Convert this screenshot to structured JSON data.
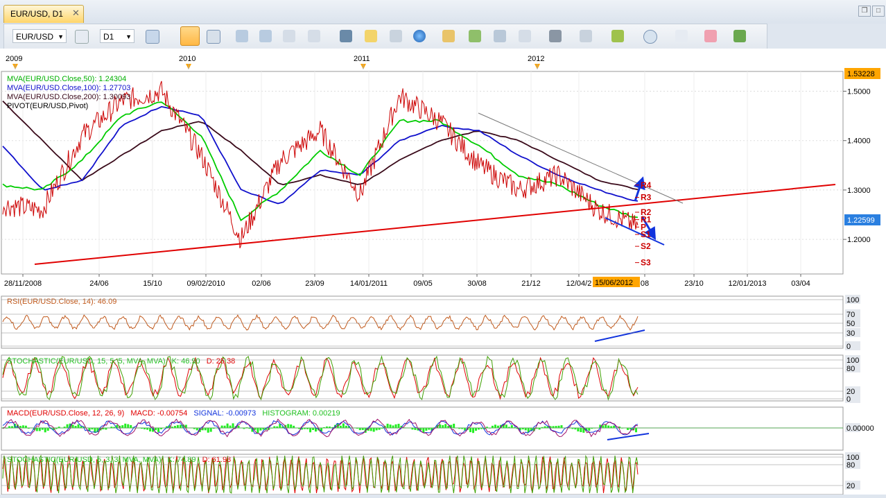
{
  "window": {
    "tab_title": "EUR/USD, D1",
    "close_glyph": "✕"
  },
  "toolbar": {
    "symbol": "EUR/USD",
    "timeframe": "D1"
  },
  "colors": {
    "background": "#ffffff",
    "grid": "#d8d8d8",
    "price": "#cc0000",
    "ma50": "#00cc00",
    "ma100": "#1010cc",
    "ma200": "#3a0a1a",
    "trend": "#e00000",
    "arrow": "#1133dd",
    "accent": "#ffa500"
  },
  "main_panel": {
    "legend": [
      {
        "text": "MVA(EUR/USD.Close,50): 1.24304",
        "color": "#00b000"
      },
      {
        "text": "MVA(EUR/USD.Close,100): 1.27703",
        "color": "#1010cc"
      },
      {
        "text": "MVA(EUR/USD.Close,200): 1.30093",
        "color": "#3a0a1a"
      },
      {
        "text": "PIVOT(EUR/USD,Pivot)",
        "color": "#000000"
      }
    ],
    "years": [
      "2009",
      "2010",
      "2011",
      "2012"
    ],
    "price_ticks": [
      "1.5000",
      "1.4000",
      "1.3000",
      "1.2000"
    ],
    "ylim": [
      1.13,
      1.54
    ],
    "high_label": "1.53228",
    "current_label": "1.22599",
    "date_ticks": [
      "28/11/2008",
      "24/06",
      "15/10",
      "09/02/2010",
      "02/06",
      "23/09",
      "14/01/2011",
      "09/05",
      "30/08",
      "21/12",
      "12/04/2",
      "08",
      "23/10",
      "12/01/2013",
      "03/04"
    ],
    "cursor_date": "15/06/2012",
    "pivots": [
      {
        "label": "R4",
        "value": 1.31
      },
      {
        "label": "R3",
        "value": 1.285
      },
      {
        "label": "R2",
        "value": 1.255
      },
      {
        "label": "R1",
        "value": 1.24
      },
      {
        "label": "P",
        "value": 1.225
      },
      {
        "label": "S1",
        "value": 1.21
      },
      {
        "label": "S2",
        "value": 1.186
      },
      {
        "label": "S3",
        "value": 1.153
      }
    ]
  },
  "rsi_panel": {
    "legend": "RSI(EUR/USD.Close, 14): 46.09",
    "ticks": [
      "100",
      "70",
      "50",
      "30",
      "0"
    ]
  },
  "stoch1_panel": {
    "legend_name": "STOCHASTIC(EUR/USD, 15, 5, 5, MVA, MVA)",
    "k": "K: 46.90",
    "d": "D: 25.38",
    "ticks": [
      "100",
      "80",
      "20",
      "0"
    ]
  },
  "macd_panel": {
    "legend_name": "MACD(EUR/USD.Close, 12, 26, 9)",
    "macd": "MACD: -0.00754",
    "signal": "SIGNAL: -0.00973",
    "hist": "HISTOGRAM: 0.00219",
    "ticks": [
      "0.00000"
    ]
  },
  "stoch2_panel": {
    "legend_name": "STOCHASTIC(EUR/USD, 5, 3, 3, MVA, MVA)",
    "k": "K: 74.89",
    "d": "D: 61.98",
    "ticks": [
      "100",
      "80",
      "20"
    ]
  },
  "chart_data": {
    "type": "line",
    "title": "EUR/USD, D1",
    "x": [
      "2008-11",
      "2009-03",
      "2009-06",
      "2009-10",
      "2009-11",
      "2010-02",
      "2010-06",
      "2010-09",
      "2010-11",
      "2011-01",
      "2011-05",
      "2011-08",
      "2011-10",
      "2011-12",
      "2012-04",
      "2012-06",
      "2012-07"
    ],
    "series": [
      {
        "name": "EUR/USD",
        "values": [
          1.27,
          1.26,
          1.41,
          1.48,
          1.5,
          1.37,
          1.2,
          1.36,
          1.42,
          1.29,
          1.49,
          1.44,
          1.35,
          1.3,
          1.33,
          1.26,
          1.226
        ]
      },
      {
        "name": "MVA(EUR/USD.Close,50)",
        "values": [
          1.31,
          1.3,
          1.36,
          1.45,
          1.48,
          1.41,
          1.24,
          1.3,
          1.38,
          1.33,
          1.44,
          1.44,
          1.39,
          1.33,
          1.31,
          1.27,
          1.243
        ]
      },
      {
        "name": "MVA(EUR/USD.Close,100)",
        "values": [
          1.39,
          1.3,
          1.32,
          1.43,
          1.47,
          1.45,
          1.3,
          1.27,
          1.34,
          1.33,
          1.4,
          1.43,
          1.42,
          1.37,
          1.33,
          1.3,
          1.277
        ]
      },
      {
        "name": "MVA(EUR/USD.Close,200)",
        "values": [
          1.48,
          1.4,
          1.32,
          1.37,
          1.42,
          1.44,
          1.38,
          1.31,
          1.33,
          1.31,
          1.36,
          1.4,
          1.42,
          1.4,
          1.36,
          1.32,
          1.301
        ]
      }
    ],
    "rsi_last": 46.09,
    "stoch_15_k": 46.9,
    "stoch_15_d": 25.38,
    "macd": -0.00754,
    "macd_signal": -0.00973,
    "macd_histogram": 0.00219,
    "stoch_5_k": 74.89,
    "stoch_5_d": 61.98
  }
}
